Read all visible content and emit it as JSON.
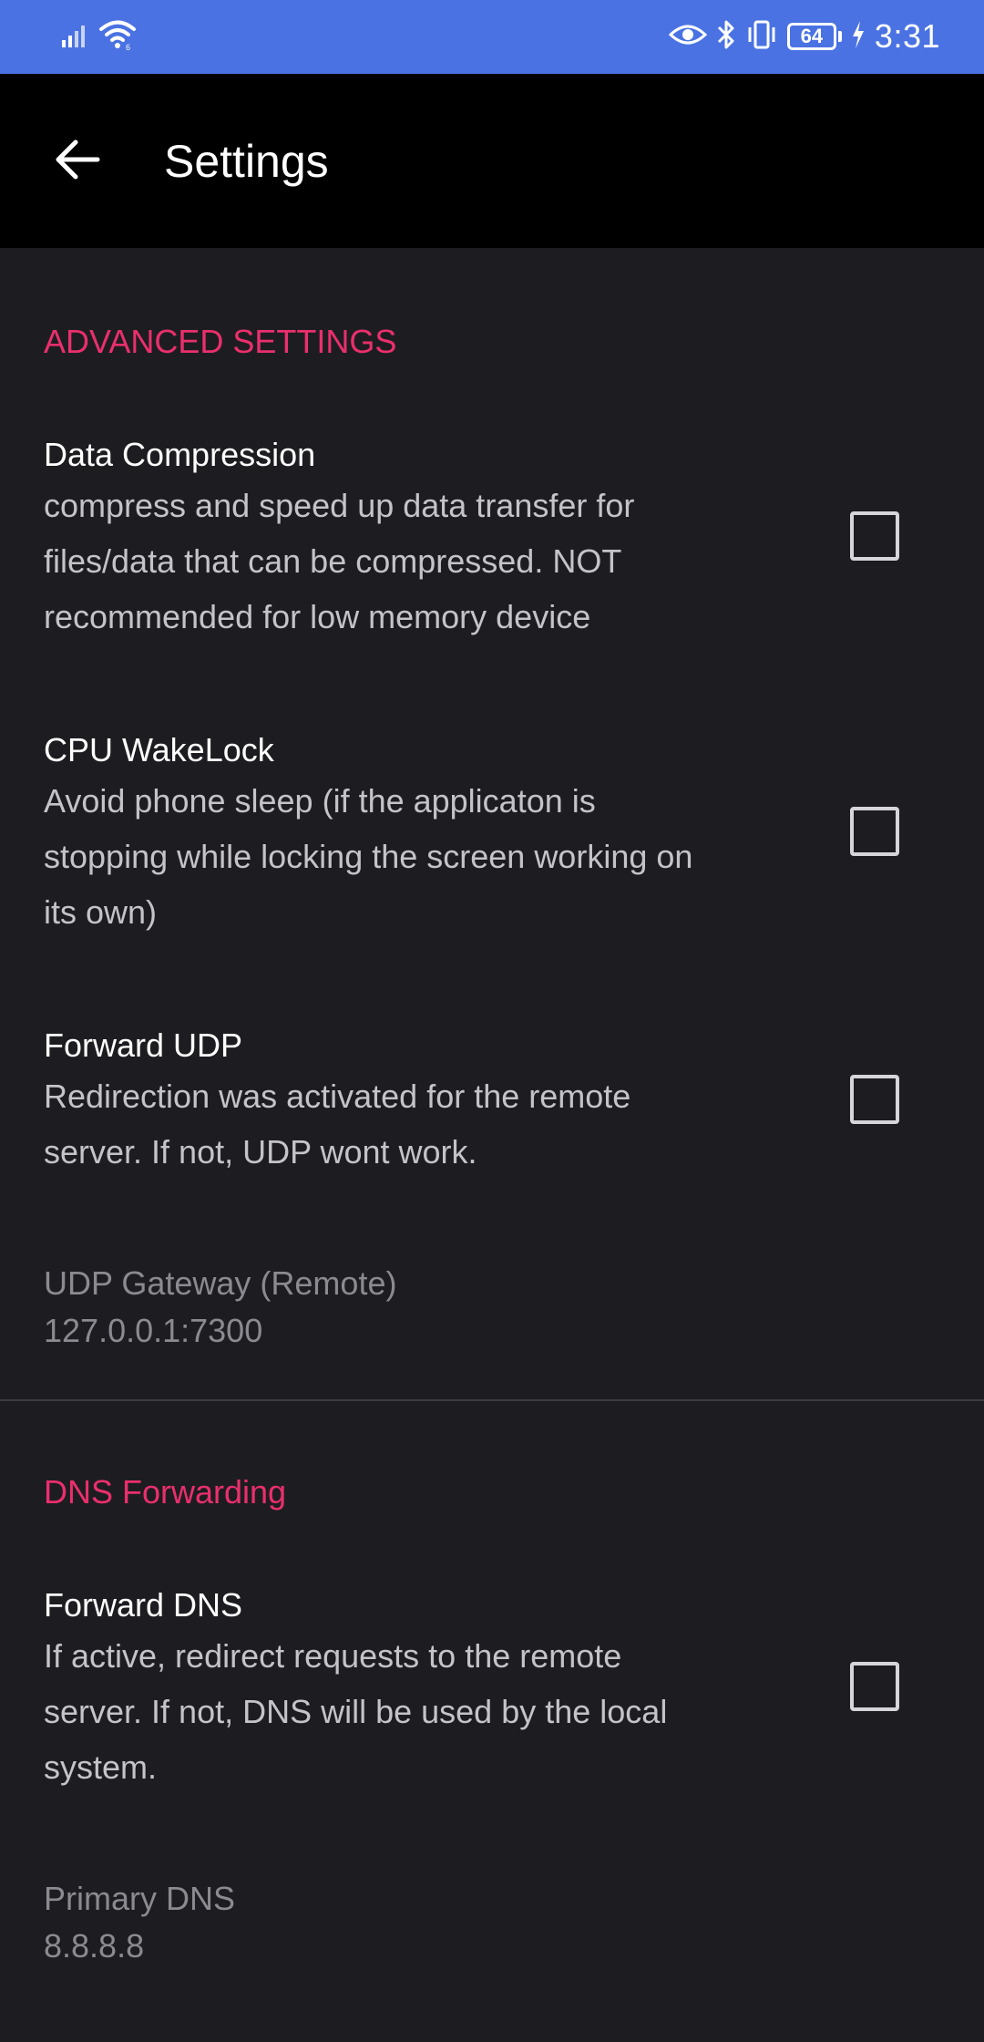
{
  "status_bar": {
    "time": "3:31",
    "battery_level": "64",
    "icons": [
      "signal-icon",
      "wifi-icon",
      "eye-icon",
      "bluetooth-icon",
      "vibrate-icon",
      "battery-icon",
      "charging-icon"
    ],
    "background_color": "#4a72e3"
  },
  "app_bar": {
    "title": "Settings",
    "back_icon": "arrow-left-icon"
  },
  "sections": {
    "advanced": {
      "header": "ADVANCED SETTINGS",
      "data_compression": {
        "title": "Data Compression",
        "summary_lines": [
          "compress and speed up data transfer for",
          "files/data that can be compressed. NOT",
          "recommended for low memory device"
        ],
        "checked": false
      },
      "cpu_wakelock": {
        "title": "CPU WakeLock",
        "summary_lines": [
          "Avoid phone sleep (if the applicaton is",
          "stopping while locking the screen working on",
          "its own)"
        ],
        "checked": false
      },
      "forward_udp": {
        "title": "Forward UDP",
        "summary_lines": [
          "Redirection was activated for the remote",
          "server. If not, UDP wont work."
        ],
        "checked": false
      },
      "udp_gateway": {
        "title": "UDP Gateway (Remote)",
        "value": "127.0.0.1:7300"
      }
    },
    "dns": {
      "header": "DNS Forwarding",
      "forward_dns": {
        "title": "Forward DNS",
        "summary_lines": [
          "If active, redirect requests to the remote",
          "server. If not, DNS will be used by the local",
          "system."
        ],
        "checked": false
      },
      "primary_dns": {
        "title": "Primary DNS",
        "value": "8.8.8.8"
      }
    }
  },
  "colors": {
    "accent": "#ea2f6c",
    "background": "#1d1d21",
    "app_bar": "#000000"
  }
}
